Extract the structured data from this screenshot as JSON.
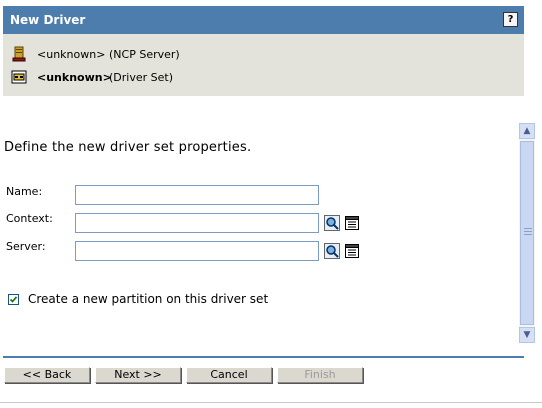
{
  "header": {
    "title": "New Driver",
    "help_label": "?"
  },
  "info": {
    "server": {
      "name": "<unknown>",
      "type": "(NCP Server)",
      "icon": "server-icon"
    },
    "driver_set": {
      "name": "<unknown>",
      "type": "(Driver Set)",
      "icon": "driver-set-icon"
    }
  },
  "main": {
    "heading": "Define the new driver set properties.",
    "fields": {
      "name_label": "Name:",
      "name_value": "",
      "context_label": "Context:",
      "context_value": "",
      "server_label": "Server:",
      "server_value": ""
    },
    "partition_checkbox": {
      "label": "Create a new partition on this driver set",
      "checked": true
    }
  },
  "buttons": {
    "back": "<< Back",
    "next": "Next >>",
    "cancel": "Cancel",
    "finish": "Finish"
  },
  "colors": {
    "title_bar": "#4d7dac",
    "info_bg": "#e3e3dc",
    "field_border": "#7a9cc6"
  }
}
